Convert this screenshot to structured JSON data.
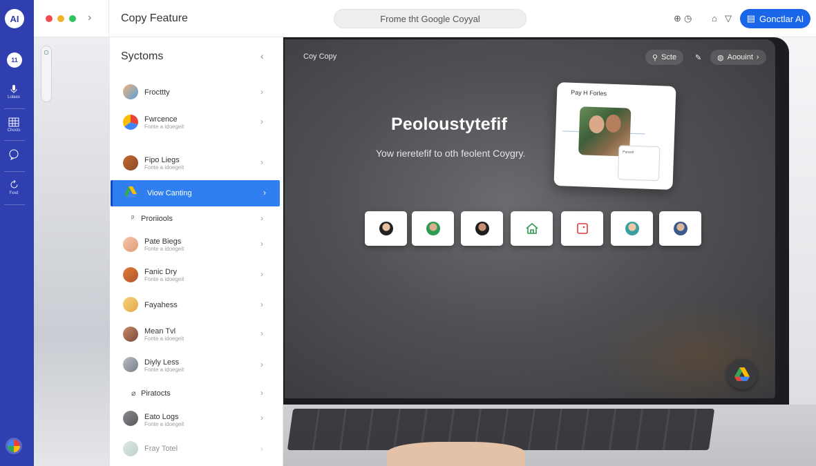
{
  "rail": {
    "logo": "AI",
    "badge": "11",
    "items": [
      {
        "label": "Lolaes"
      },
      {
        "label": "Chosts"
      },
      {
        "label": ""
      },
      {
        "label": "Fxxd"
      }
    ]
  },
  "header": {
    "title": "Copy Feature",
    "search_text": "Frome tht Google Coyyal",
    "cta_label": "Gonctlar AI"
  },
  "colors": {
    "accent": "#1a66e8",
    "rail": "#2f3fb0",
    "active_item": "#2f7ff0"
  },
  "sidebar": {
    "title": "Syctoms",
    "items": [
      {
        "title": "Frocttty",
        "subtitle": ""
      },
      {
        "title": "Fwrcence",
        "subtitle": "Fonte a idoegeit"
      },
      {
        "title": "Fipo Liegs",
        "subtitle": "Fonte a idoegeit"
      },
      {
        "title": "Viow Canting",
        "subtitle": ""
      },
      {
        "title": "Proriiools",
        "subtitle": ""
      },
      {
        "title": "Pate Biegs",
        "subtitle": "Fonte a idoegeit"
      },
      {
        "title": "Fanic Dry",
        "subtitle": "Fonte a idoegeit"
      },
      {
        "title": "Fayahess",
        "subtitle": ""
      },
      {
        "title": "Mean Tvl",
        "subtitle": "Fonte a idoegeit"
      },
      {
        "title": "Diyly Less",
        "subtitle": "Fonte a idoegeit"
      },
      {
        "title": "Piratocts",
        "subtitle": ""
      },
      {
        "title": "Eato Logs",
        "subtitle": "Fonte a idoegeit"
      },
      {
        "title": "Fray Totel",
        "subtitle": ""
      }
    ]
  },
  "screen": {
    "label": "Coy Copy",
    "pill_left": "Scte",
    "pill_right": "Aoouint",
    "headline": "Peoloustytefif",
    "subline": "Yow rieretefif to oth feolent Coygry.",
    "card_title": "Pay H Forles",
    "card_mini_text": "Paraolt"
  }
}
